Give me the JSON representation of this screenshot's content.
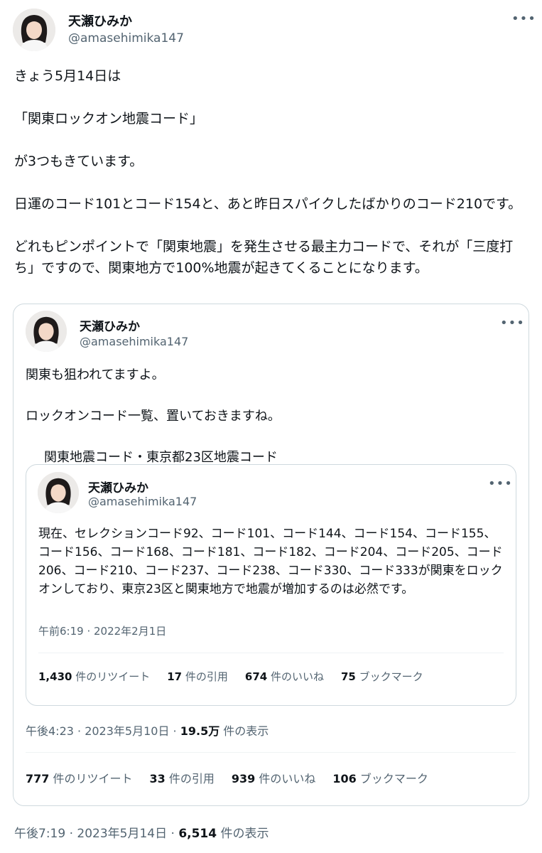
{
  "outer": {
    "name": "天瀬ひみか",
    "handle": "@amasehimika147",
    "paragraphs": [
      "きょう5月14日は",
      "「関東ロックオン地震コード」",
      "が3つもきています。",
      "日運のコード101とコード154と、あと昨日スパイクしたばかりのコード210です。",
      "どれもピンポイントで「関東地震」を発生させる最主力コードで、それが「三度打ち」ですので、関東地方で100%地震が起きてくることになります。"
    ],
    "time": "午後7:19 · 2023年5月14日 · ",
    "views_count": "6,514",
    "views_label": " 件の表示"
  },
  "quote1": {
    "name": "天瀬ひみか",
    "handle": "@amasehimika147",
    "paragraphs": [
      "関東も狙われてますよ。",
      "ロックオンコード一覧、置いておきますね。"
    ],
    "alert_line": "関東地震コード・東京都23区地震コード",
    "alert_icon": "rotating-light-icon",
    "warning_icon": "warning-icon",
    "time": "午後4:23 · 2023年5月10日 · ",
    "views_count": "19.5万",
    "views_label": " 件の表示",
    "stats": [
      {
        "count": "777",
        "label": " 件のリツイート"
      },
      {
        "count": "33",
        "label": " 件の引用"
      },
      {
        "count": "939",
        "label": " 件のいいね"
      },
      {
        "count": "106",
        "label": " ブックマーク"
      }
    ]
  },
  "quote2": {
    "name": "天瀬ひみか",
    "handle": "@amasehimika147",
    "text": "現在、セレクションコード92、コード101、コード144、コード154、コード155、コード156、コード168、コード181、コード182、コード204、コード205、コード206、コード210、コード237、コード238、コード330、コード333が関東をロックオンしており、東京23区と関東地方で地震が増加するのは必然です。",
    "time": "午前6:19 · 2022年2月1日",
    "stats": [
      {
        "count": "1,430",
        "label": " 件のリツイート"
      },
      {
        "count": "17",
        "label": " 件の引用"
      },
      {
        "count": "674",
        "label": " 件のいいね"
      },
      {
        "count": "75",
        "label": " ブックマーク"
      }
    ]
  },
  "colors": {
    "text": "#0f1419",
    "secondary": "#536471",
    "border": "#cfd9de",
    "alert_red": "#e0245e",
    "warning_yellow": "#f4b400"
  }
}
